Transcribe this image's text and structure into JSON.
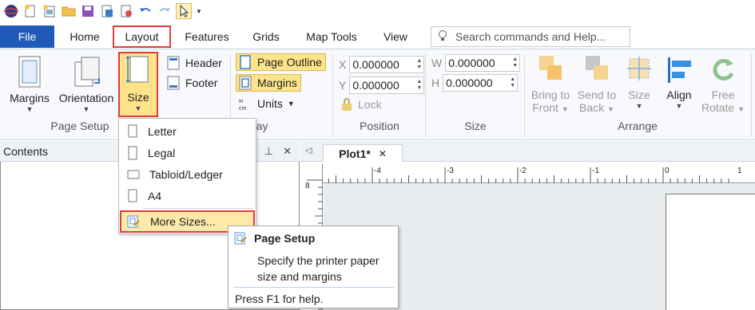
{
  "quick_access": {
    "icons": [
      "app-logo-icon",
      "new-icon",
      "new-from-template-icon",
      "open-folder-icon",
      "save-icon",
      "save-as-icon",
      "export-icon",
      "undo-icon",
      "redo-icon",
      "select-pointer-icon",
      "customize-dropdown-icon"
    ]
  },
  "tabs": {
    "file": "File",
    "home": "Home",
    "layout": "Layout",
    "features": "Features",
    "grids": "Grids",
    "map_tools": "Map Tools",
    "view": "View"
  },
  "search": {
    "placeholder": "Search commands and Help..."
  },
  "ribbon": {
    "page_setup": {
      "margins": "Margins",
      "orientation": "Orientation",
      "size": "Size",
      "label": "Page Setup"
    },
    "header": "Header",
    "footer": "Footer",
    "page_outline": "Page Outline",
    "margins_toggle": "Margins",
    "units": "Units",
    "display_label_partial": "ay",
    "position": {
      "x_label": "X",
      "x_value": "0.000000",
      "y_label": "Y",
      "y_value": "0.000000",
      "lock": "Lock",
      "label": "Position"
    },
    "size_group": {
      "w_label": "W",
      "w_value": "0.000000",
      "h_label": "H",
      "h_value": "0.000000",
      "label": "Size"
    },
    "arrange": {
      "bring_to": "Bring to",
      "front": "Front",
      "send_to": "Send to",
      "back": "Back",
      "size": "Size",
      "align": "Align",
      "free": "Free",
      "rotate": "Rotate",
      "label": "Arrange"
    }
  },
  "size_menu": {
    "items": [
      "Letter",
      "Legal",
      "Tabloid/Ledger",
      "A4"
    ],
    "more": "More Sizes..."
  },
  "tooltip": {
    "title": "Page Setup",
    "description": "Specify the printer paper size and margins",
    "help": "Press F1 for help."
  },
  "contents_pane": {
    "title": "Contents"
  },
  "document": {
    "tab_title": "Plot1*",
    "ruler_labels": [
      "-4",
      "-3",
      "-2",
      "-1",
      "0",
      "1"
    ],
    "vruler_label": "8"
  },
  "colors": {
    "file_tab": "#1f5ab8",
    "highlight": "#fde48a",
    "annotation_red": "#e23b3b"
  }
}
